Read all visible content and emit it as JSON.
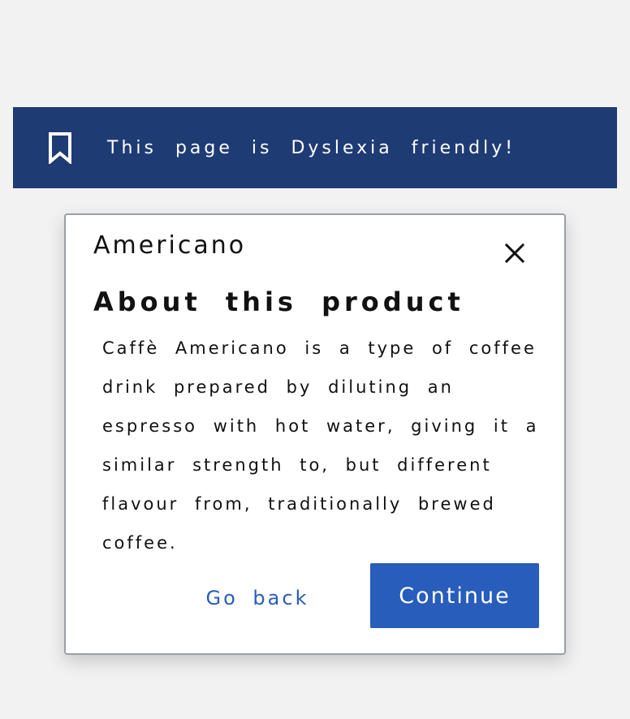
{
  "banner": {
    "icon": "bookmark-icon",
    "text": "This page is Dyslexia friendly!",
    "background": "#1f3b74"
  },
  "dialog": {
    "title": "Americano",
    "close_icon": "close-icon",
    "heading": "About this product",
    "description": "Caffè Americano is a type of coffee drink prepared by diluting an espresso with hot water, giving it a similar strength to, but different flavour from, traditionally brewed coffee.",
    "secondary_button": "Go back",
    "primary_button": "Continue",
    "accent_color": "#285dbb"
  }
}
